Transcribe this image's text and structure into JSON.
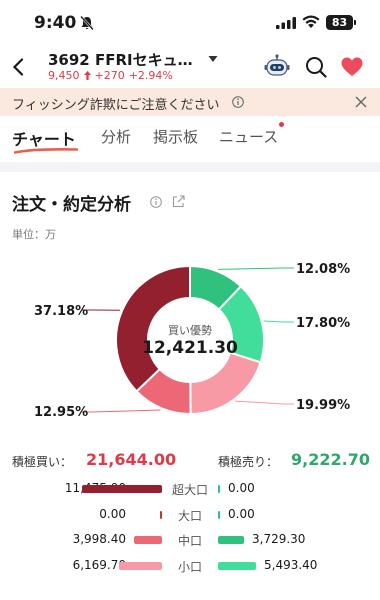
{
  "status_bar": {
    "time": "9:40",
    "battery": "83"
  },
  "header": {
    "code": "3692",
    "name": "FFRIセキュ…",
    "price": "9,450",
    "change": "+270",
    "change_pct": "+2.94%"
  },
  "banner": {
    "text": "フィッシング詐欺にご注意ください"
  },
  "tabs": [
    {
      "label": "チャート",
      "active": true
    },
    {
      "label": "分析",
      "active": false
    },
    {
      "label": "掲示板",
      "active": false
    },
    {
      "label": "ニュース",
      "active": false,
      "has_badge": true
    }
  ],
  "section": {
    "title": "注文・約定分析",
    "unit": "単位：万"
  },
  "donut": {
    "center_label": "買い優勢",
    "center_value": "12,421.30",
    "segments": [
      {
        "label": "12.08%",
        "value": 12.08,
        "color": "#2ec27e"
      },
      {
        "label": "17.80%",
        "value": 17.8,
        "color": "#41dd9a"
      },
      {
        "label": "19.99%",
        "value": 19.99,
        "color": "#f89aa5"
      },
      {
        "label": "12.95%",
        "value": 12.95,
        "color": "#ec6877"
      },
      {
        "label": "37.18%",
        "value": 37.18,
        "color": "#92202f"
      }
    ]
  },
  "totals": {
    "buy_label": "積極買い：",
    "buy_value": "21,644.00",
    "sell_label": "積極売り：",
    "sell_value": "9,222.70"
  },
  "rows": [
    {
      "label": "超大口",
      "buy": "11,475.90",
      "sell": "0.00",
      "buy_color": "#92202f",
      "sell_color": "#2ec27e",
      "buy_frac": 1.0,
      "sell_frac": 0.0
    },
    {
      "label": "大口",
      "buy": "0.00",
      "sell": "0.00",
      "buy_color": "#c0392b",
      "sell_color": "#2ec27e",
      "buy_frac": 0.0,
      "sell_frac": 0.0
    },
    {
      "label": "中口",
      "buy": "3,998.40",
      "sell": "3,729.30",
      "buy_color": "#ec6877",
      "sell_color": "#2ec27e",
      "buy_frac": 0.35,
      "sell_frac": 0.33
    },
    {
      "label": "小口",
      "buy": "6,169.70",
      "sell": "5,493.40",
      "buy_color": "#f89aa5",
      "sell_color": "#41dd9a",
      "buy_frac": 0.54,
      "sell_frac": 0.48
    }
  ],
  "colors": {
    "up": "#e03a4a",
    "down": "#2ea86b",
    "banner_bg": "#fbe8de",
    "tab_accent": "#e8604c"
  }
}
